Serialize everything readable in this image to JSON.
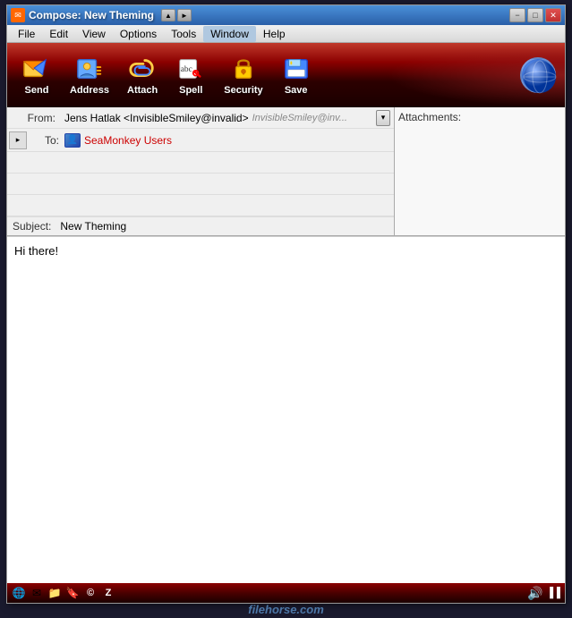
{
  "window": {
    "title": "Compose: New Theming",
    "icon": "✉"
  },
  "title_buttons": {
    "minimize": "−",
    "maximize": "□",
    "close": "✕",
    "nav_back": "▲",
    "nav_forward": "►"
  },
  "menu": {
    "items": [
      {
        "label": "File",
        "id": "file"
      },
      {
        "label": "Edit",
        "id": "edit"
      },
      {
        "label": "View",
        "id": "view"
      },
      {
        "label": "Options",
        "id": "options"
      },
      {
        "label": "Tools",
        "id": "tools"
      },
      {
        "label": "Window",
        "id": "window"
      },
      {
        "label": "Help",
        "id": "help"
      }
    ]
  },
  "toolbar": {
    "buttons": [
      {
        "label": "Send",
        "icon": "✉",
        "id": "send"
      },
      {
        "label": "Address",
        "icon": "👥",
        "id": "address"
      },
      {
        "label": "Attach",
        "icon": "📎",
        "id": "attach"
      },
      {
        "label": "Spell",
        "icon": "abc",
        "id": "spell"
      },
      {
        "label": "Security",
        "icon": "🔒",
        "id": "security"
      },
      {
        "label": "Save",
        "icon": "💾",
        "id": "save"
      }
    ]
  },
  "header": {
    "from_label": "From:",
    "from_name": "Jens Hatlak <InvisibleSmiley@invalid>",
    "from_ghost": "InvisibleSmiley@inv...",
    "to_label": "To:",
    "to_toggle": "▸",
    "recipient_name": "SeaMonkey Users",
    "subject_label": "Subject:",
    "subject_value": "New Theming",
    "attachments_label": "Attachments:"
  },
  "body": {
    "text": "Hi there!"
  },
  "status_bar": {
    "icons": [
      "🌐",
      "✉",
      "📁",
      "🔖",
      "©",
      "Z"
    ]
  },
  "watermark": {
    "text": "filehorse",
    "suffix": ".com"
  }
}
